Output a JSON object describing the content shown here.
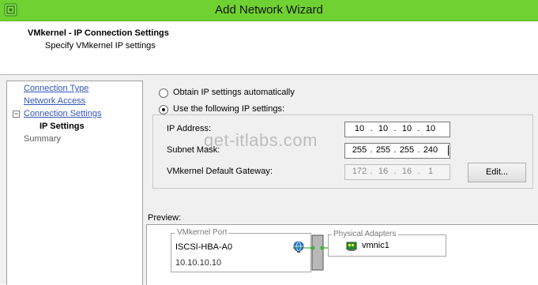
{
  "window": {
    "title": "Add Network Wizard",
    "accent_color": "#70d232",
    "icon": "vsphere-app-icon"
  },
  "header": {
    "title": "VMkernel - IP Connection Settings",
    "subtitle": "Specify VMkernel IP settings"
  },
  "nav": {
    "items": [
      {
        "label": "Connection Type",
        "state": "link"
      },
      {
        "label": "Network Access",
        "state": "link"
      },
      {
        "label": "Connection Settings",
        "state": "link-expanded"
      },
      {
        "label": "IP Settings",
        "state": "current"
      },
      {
        "label": "Summary",
        "state": "pending"
      }
    ],
    "collapse_glyph": "−"
  },
  "ip": {
    "auto_label": "Obtain IP settings automatically",
    "manual_label": "Use the following IP settings:",
    "selected": "manual",
    "address": {
      "label": "IP Address:",
      "octets": [
        "10",
        "10",
        "10",
        "10"
      ]
    },
    "subnet": {
      "label": "Subnet Mask:",
      "octets": [
        "255",
        "255",
        "255",
        "240"
      ]
    },
    "gateway": {
      "label": "VMkernel Default Gateway:",
      "octets": [
        "172",
        "16",
        "16",
        "1"
      ],
      "disabled": true
    },
    "edit_button": "Edit...",
    "separator": "."
  },
  "preview": {
    "label": "Preview:",
    "vmkernel_port": {
      "title": "VMkernel Port",
      "name": "ISCSI-HBA-A0",
      "ip": "10.10.10.10"
    },
    "physical_adapters": {
      "title": "Physical Adapters",
      "nic": "vmnic1"
    }
  },
  "watermark": "get-itlabs.com"
}
